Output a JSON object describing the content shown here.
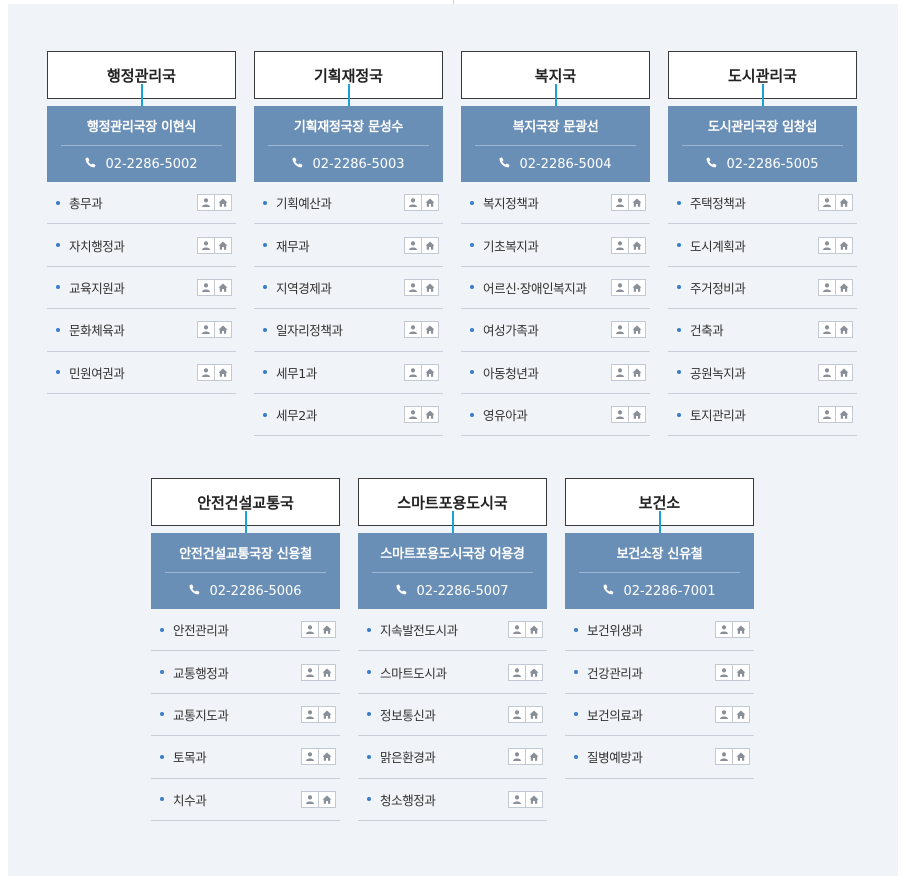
{
  "rows": [
    [
      {
        "bureau": "행정관리국",
        "head": "행정관리국장 이현식",
        "phone": "02-2286-5002",
        "divisions": [
          "총무과",
          "자치행정과",
          "교육지원과",
          "문화체육과",
          "민원여권과"
        ]
      },
      {
        "bureau": "기획재정국",
        "head": "기획재정국장 문성수",
        "phone": "02-2286-5003",
        "divisions": [
          "기획예산과",
          "재무과",
          "지역경제과",
          "일자리정책과",
          "세무1과",
          "세무2과"
        ]
      },
      {
        "bureau": "복지국",
        "head": "복지국장 문광선",
        "phone": "02-2286-5004",
        "divisions": [
          "복지정책과",
          "기초복지과",
          "어르신·장애인복지과",
          "여성가족과",
          "아동청년과",
          "영유아과"
        ]
      },
      {
        "bureau": "도시관리국",
        "head": "도시관리국장 임창섭",
        "phone": "02-2286-5005",
        "divisions": [
          "주택정책과",
          "도시계획과",
          "주거정비과",
          "건축과",
          "공원녹지과",
          "토지관리과"
        ]
      }
    ],
    [
      {
        "bureau": "안전건설교통국",
        "head": "안전건설교통국장 신용철",
        "phone": "02-2286-5006",
        "divisions": [
          "안전관리과",
          "교통행정과",
          "교통지도과",
          "토목과",
          "치수과"
        ]
      },
      {
        "bureau": "스마트포용도시국",
        "head": "스마트포용도시국장 어용경",
        "phone": "02-2286-5007",
        "divisions": [
          "지속발전도시과",
          "스마트도시과",
          "정보통신과",
          "맑은환경과",
          "청소행정과"
        ]
      },
      {
        "bureau": "보건소",
        "head": "보건소장 신유철",
        "phone": "02-2286-7001",
        "divisions": [
          "보건위생과",
          "건강관리과",
          "보건의료과",
          "질병예방과"
        ]
      }
    ]
  ],
  "icons": {
    "phone": "phone-icon",
    "staff": "person-icon",
    "home": "home-icon"
  },
  "colors": {
    "accent": "#1aa3d6",
    "head_bg": "#6a8fb7",
    "panel_bg": "#f0f3f7",
    "bullet": "#3a7ec9"
  }
}
